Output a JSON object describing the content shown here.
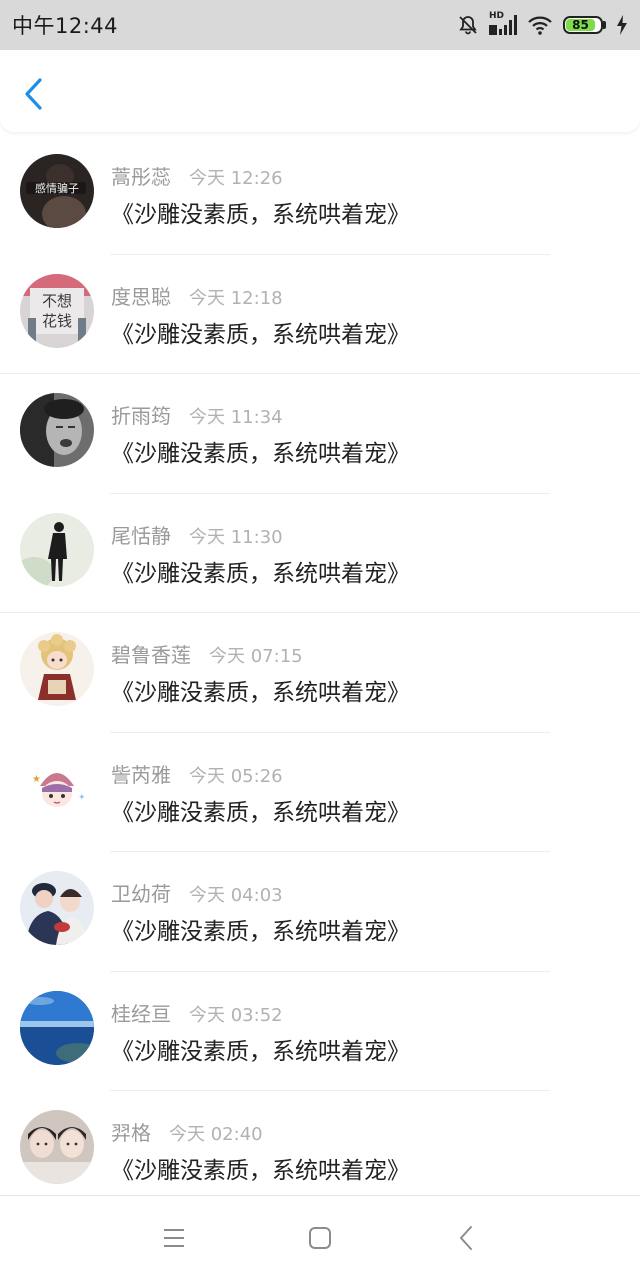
{
  "status_bar": {
    "time": "中午12:44",
    "battery": "85",
    "network_label": "HD",
    "icons": [
      "bell-muted-icon",
      "signal-icon",
      "wifi-icon",
      "battery-icon",
      "charging-icon"
    ]
  },
  "nav": {
    "back_icon": "chevron-left-icon",
    "accent_color": "#1e8ee6"
  },
  "list": {
    "items": [
      {
        "name": "蒿彤蕊",
        "time": "今天 12:26",
        "title": "《沙雕没素质，系统哄着宠》",
        "avatar": "avatar-dark-portrait"
      },
      {
        "name": "度思聪",
        "time": "今天 12:18",
        "title": "《沙雕没素质，系统哄着宠》",
        "avatar": "avatar-text-image"
      },
      {
        "name": "折雨筠",
        "time": "今天 11:34",
        "title": "《沙雕没素质，系统哄着宠》",
        "avatar": "avatar-bw-face"
      },
      {
        "name": "尾恬静",
        "time": "今天 11:30",
        "title": "《沙雕没素质，系统哄着宠》",
        "avatar": "avatar-silhouette"
      },
      {
        "name": "碧鲁香莲",
        "time": "今天 07:15",
        "title": "《沙雕没素质，系统哄着宠》",
        "avatar": "avatar-cartoon-girl"
      },
      {
        "name": "訾芮雅",
        "time": "今天 05:26",
        "title": "《沙雕没素质，系统哄着宠》",
        "avatar": "avatar-cartoon-hat"
      },
      {
        "name": "卫幼荷",
        "time": "今天 04:03",
        "title": "《沙雕没素质，系统哄着宠》",
        "avatar": "avatar-couple"
      },
      {
        "name": "桂经亘",
        "time": "今天 03:52",
        "title": "《沙雕没素质，系统哄着宠》",
        "avatar": "avatar-sea"
      },
      {
        "name": "羿格",
        "time": "今天 02:40",
        "title": "《沙雕没素质，系统哄着宠》",
        "avatar": "avatar-friends"
      }
    ]
  },
  "system_nav": {
    "icons": [
      "menu-icon",
      "home-icon",
      "back-icon"
    ]
  }
}
